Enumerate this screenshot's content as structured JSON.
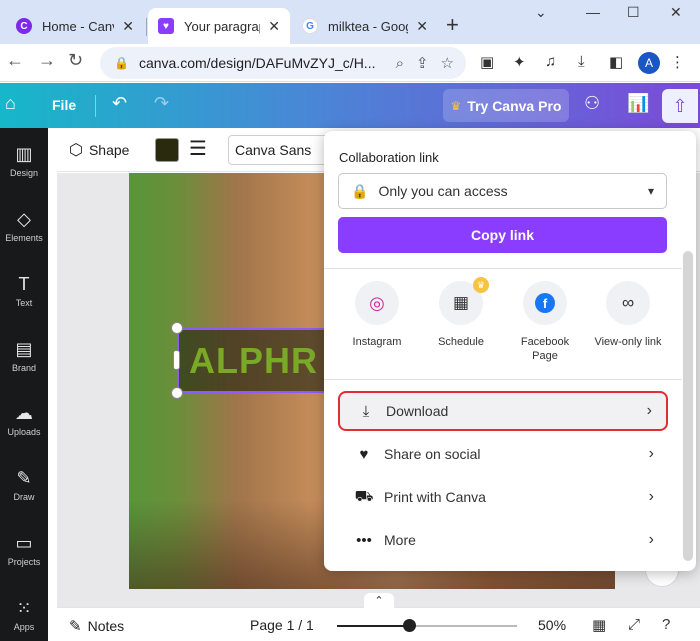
{
  "browser": {
    "tabs": [
      {
        "title": "Home - Canva",
        "favicon": "canva-logo-icon"
      },
      {
        "title": "Your paragraph",
        "favicon": "canva-heart-icon"
      },
      {
        "title": "milktea - Goog",
        "favicon": "google-logo-icon"
      }
    ],
    "new_tab": "+",
    "url": "canva.com/design/DAFuMvZYJ_c/H...",
    "avatar_letter": "A"
  },
  "canva_header": {
    "file_label": "File",
    "try_pro_label": "Try Canva Pro"
  },
  "left_rail": {
    "items": [
      {
        "label": "Design",
        "icon": "layout-icon"
      },
      {
        "label": "Elements",
        "icon": "shapes-icon"
      },
      {
        "label": "Text",
        "icon": "text-icon"
      },
      {
        "label": "Brand",
        "icon": "brand-icon"
      },
      {
        "label": "Uploads",
        "icon": "upload-cloud-icon"
      },
      {
        "label": "Draw",
        "icon": "pen-icon"
      },
      {
        "label": "Projects",
        "icon": "folder-icon"
      },
      {
        "label": "Apps",
        "icon": "grid-icon"
      }
    ]
  },
  "editor_toolbar": {
    "shape_label": "Shape",
    "font_name": "Canva Sans",
    "color_swatch": "#2a2a0e"
  },
  "canvas": {
    "text": "ALPHR"
  },
  "share_panel": {
    "collab_label": "Collaboration link",
    "access_value": "Only you can access",
    "copy_link_label": "Copy link",
    "share_options": [
      {
        "label": "Instagram",
        "icon": "instagram-icon"
      },
      {
        "label": "Schedule",
        "icon": "calendar-icon"
      },
      {
        "label": "Facebook Page",
        "icon": "facebook-icon"
      },
      {
        "label": "View-only link",
        "icon": "link-icon"
      }
    ],
    "menu": [
      {
        "label": "Download",
        "icon": "download-icon",
        "highlighted": true
      },
      {
        "label": "Share on social",
        "icon": "heart-share-icon"
      },
      {
        "label": "Print with Canva",
        "icon": "truck-icon"
      },
      {
        "label": "More",
        "icon": "more-dots-icon"
      }
    ]
  },
  "bottom_bar": {
    "notes_label": "Notes",
    "page_info": "Page 1 / 1",
    "zoom_label": "50%",
    "zoom_fraction": 0.4
  },
  "colors": {
    "accent_purple": "#8b3dff",
    "highlight_red": "#e02d37",
    "rail_bg": "#18191b"
  }
}
